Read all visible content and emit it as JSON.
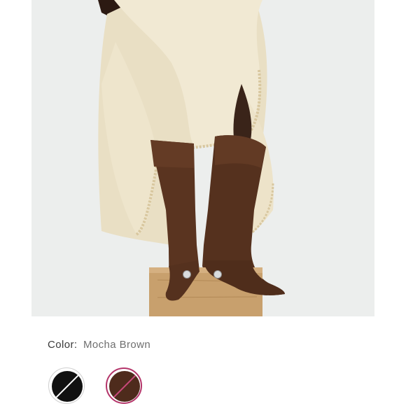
{
  "product": {
    "color_label": "Color:",
    "selected_color": "Mocha Brown"
  },
  "swatches": [
    {
      "name": "Black",
      "color": "#111111",
      "available": false,
      "selected": false
    },
    {
      "name": "Mocha Brown",
      "color": "#4e2b1c",
      "available": false,
      "selected": true
    }
  ],
  "colors": {
    "selected_ring": "#b4356a",
    "skirt": "#eee5cd",
    "boot": "#5a3420",
    "box": "#c69c6a",
    "background": "#eceeed"
  },
  "icons": {
    "black_swatch_slash": "unavailable-slash-icon",
    "brown_swatch_slash": "unavailable-slash-icon"
  }
}
